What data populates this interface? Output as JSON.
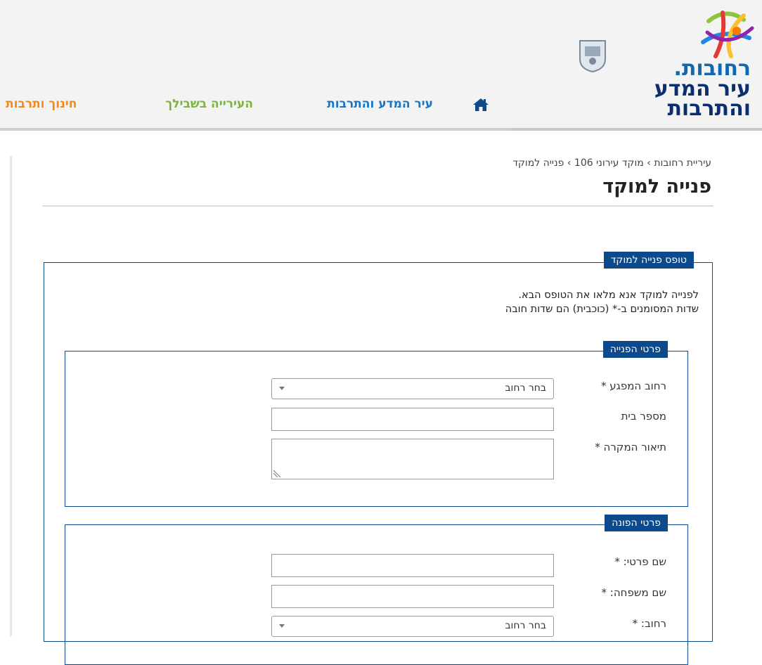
{
  "header": {
    "logo": {
      "line1": "רחובות.",
      "line2": "עיר המדע",
      "line3": "והתרבות",
      "emblem_icon": "city-emblem",
      "mark_icon": "colorful-star-mark"
    },
    "nav": [
      {
        "label": "עיר המדע והתרבות",
        "color": "#1a74c4"
      },
      {
        "label": "העירייה בשבילך",
        "color": "#7cb342"
      },
      {
        "label": "חינוך ותרבות",
        "color": "#f18a1c"
      }
    ],
    "home_icon": "home-icon"
  },
  "breadcrumb": {
    "items": [
      "עיריית רחובות",
      "מוקד עירוני 106",
      "פנייה למוקד"
    ],
    "separator": "›"
  },
  "page_title": "פנייה למוקד",
  "form": {
    "legend": "טופס פנייה למוקד",
    "intro_line1": "לפנייה למוקד אנא מלאו את הטופס הבא.",
    "intro_line2": "שדות המסומנים ב-* (כוכבית) הם שדות חובה",
    "request_section": {
      "legend": "פרטי הפנייה",
      "street_label": "רחוב המפגע *",
      "street_select": "בחר רחוב",
      "house_number_label": "מספר בית",
      "house_number_value": "",
      "description_label": "תיאור המקרה *",
      "description_value": ""
    },
    "applicant_section": {
      "legend": "פרטי הפונה",
      "first_name_label": "שם פרטי: *",
      "first_name_value": "",
      "last_name_label": "שם משפחה: *",
      "last_name_value": "",
      "street_label": "רחוב: *",
      "street_select": "בחר רחוב"
    }
  },
  "colors": {
    "primary": "#0d4a8c",
    "logo_blue": "#0c2e6e"
  }
}
